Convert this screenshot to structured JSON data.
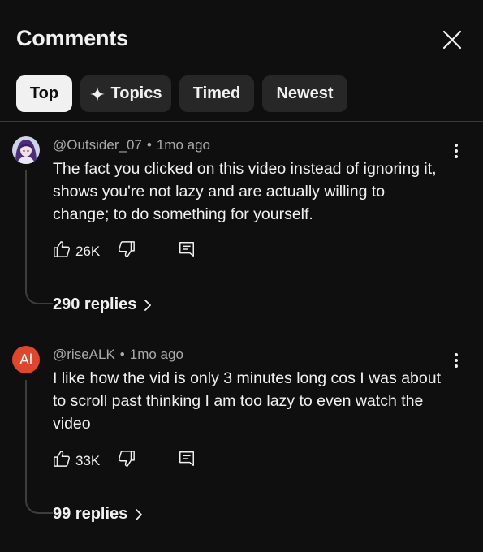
{
  "header": {
    "title": "Comments"
  },
  "filters": [
    {
      "label": "Top",
      "active": true
    },
    {
      "label": "Topics",
      "active": false,
      "icon": "sparkle-icon"
    },
    {
      "label": "Timed",
      "active": false
    },
    {
      "label": "Newest",
      "active": false
    }
  ],
  "comments": [
    {
      "author": "@Outsider_07",
      "age": "1mo ago",
      "avatar": "anime-avatar",
      "text": "The fact you clicked on this video instead of ignoring it, shows you're not lazy and are actually willing to change; to do something for yourself.",
      "likes": "26K",
      "replies": "290 replies"
    },
    {
      "author": "@riseALK",
      "age": "1mo ago",
      "avatar_letter": "Al",
      "avatar_color": "#e1452b",
      "text": "I like how the vid is only 3 minutes long cos I was about to scroll past thinking I am too lazy to even watch the video",
      "likes": "33K",
      "replies": "99 replies"
    }
  ],
  "separator": "•",
  "colors": {
    "background": "#0f0f0f",
    "chip": "#272727",
    "chip_active": "#f1f1f1",
    "meta": "#aaaaaa"
  }
}
